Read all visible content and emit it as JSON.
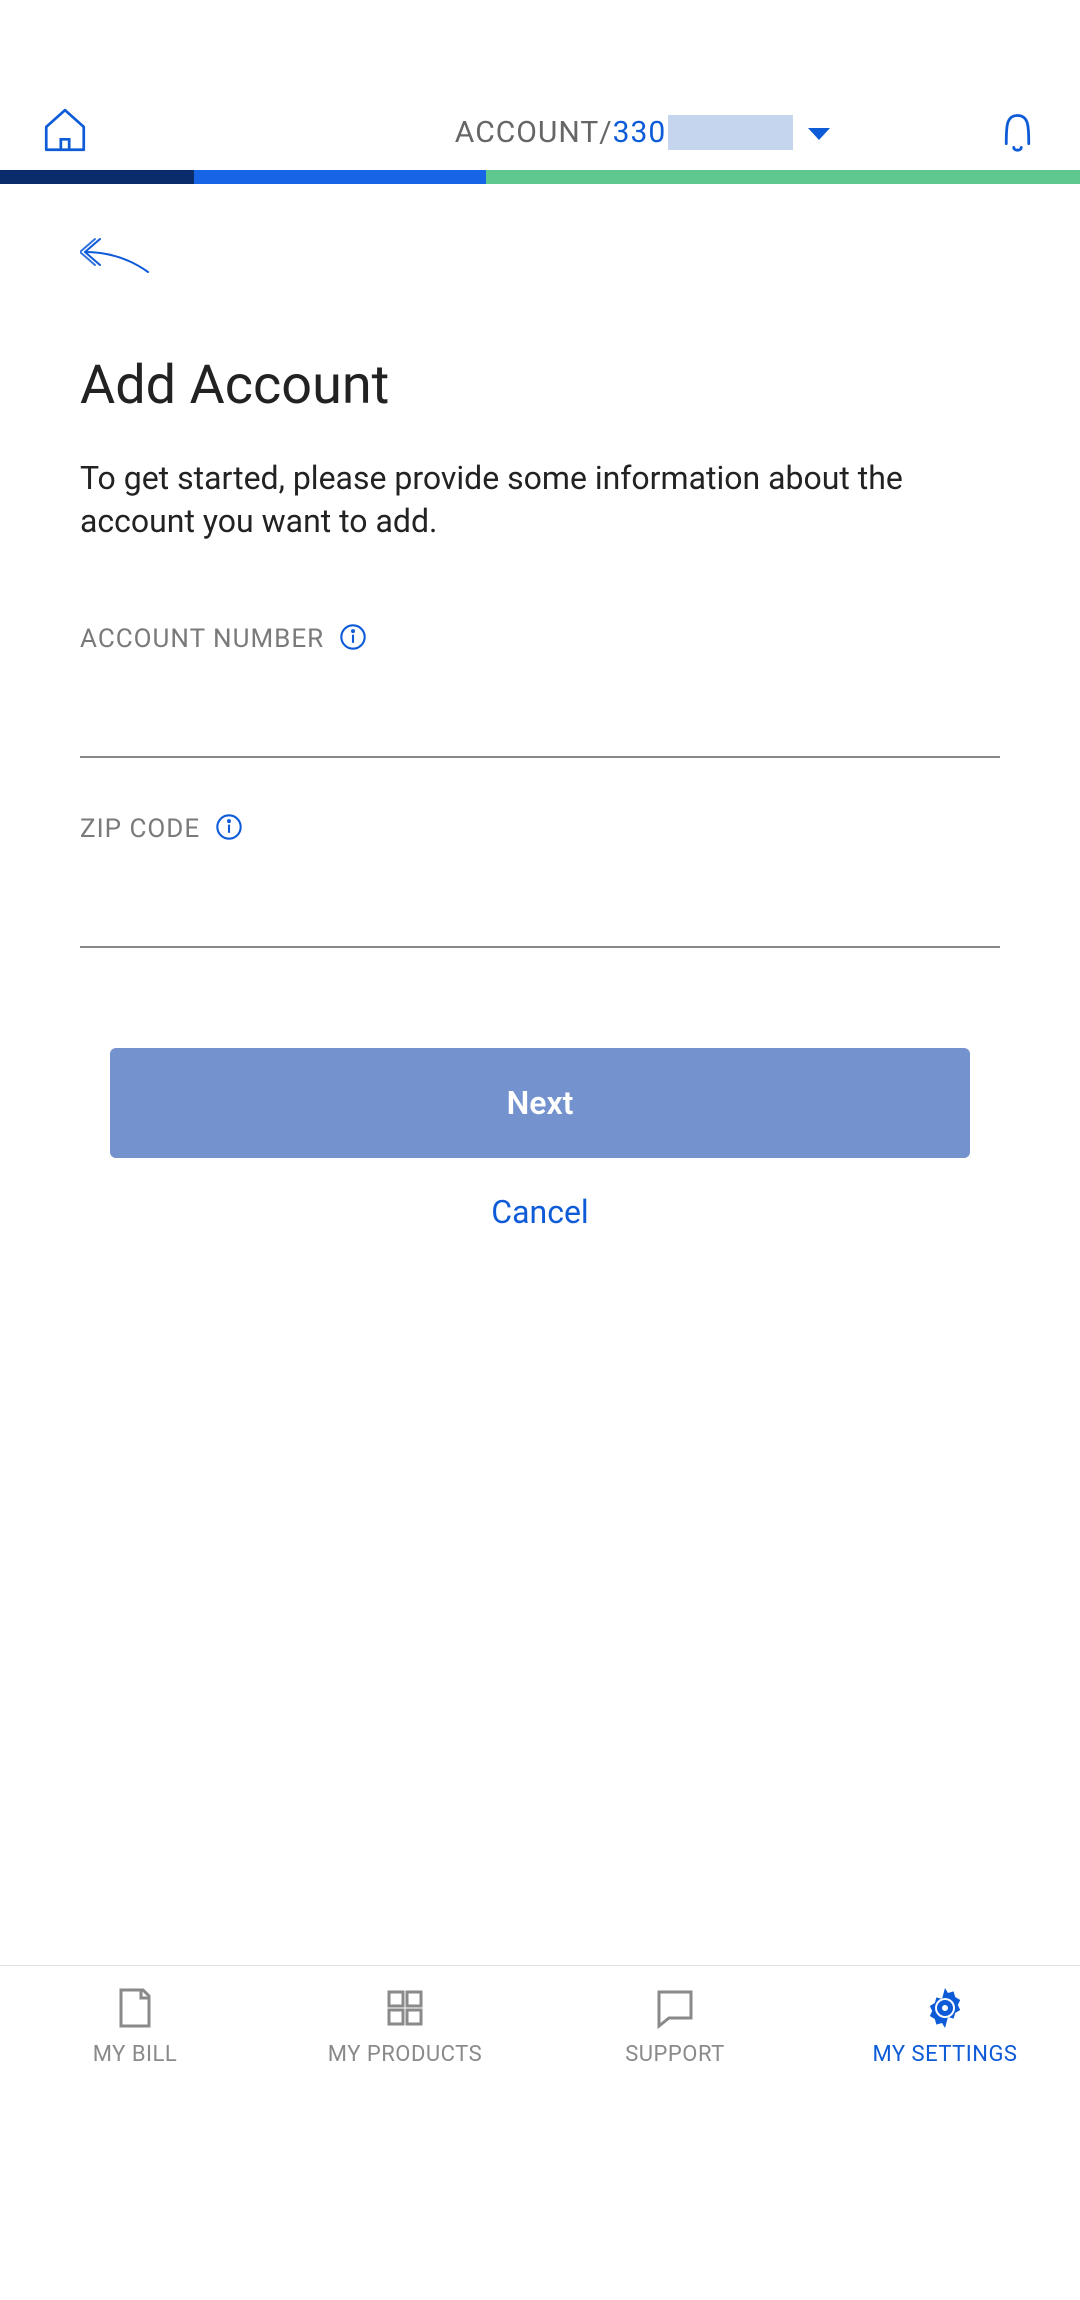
{
  "header": {
    "account_label": "ACCOUNT/",
    "account_number_visible": "330"
  },
  "page": {
    "title": "Add Account",
    "description": "To get started, please provide some information about the account you want to add."
  },
  "fields": {
    "account_number": {
      "label": "ACCOUNT NUMBER",
      "value": ""
    },
    "zip_code": {
      "label": "ZIP CODE",
      "value": ""
    }
  },
  "buttons": {
    "next": "Next",
    "cancel": "Cancel"
  },
  "bottom_nav": {
    "items": [
      {
        "label": "MY BILL",
        "icon": "bill-icon",
        "active": false
      },
      {
        "label": "MY PRODUCTS",
        "icon": "grid-icon",
        "active": false
      },
      {
        "label": "SUPPORT",
        "icon": "chat-icon",
        "active": false
      },
      {
        "label": "MY SETTINGS",
        "icon": "gear-icon",
        "active": true
      }
    ]
  }
}
